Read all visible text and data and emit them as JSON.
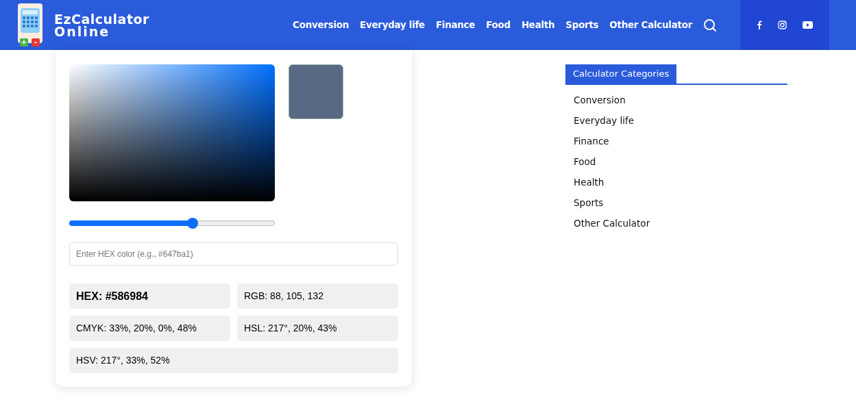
{
  "header": {
    "logo_line_1": "EzCalculator",
    "logo_line_2": "Online",
    "logo_plus": "+",
    "logo_minus": "-",
    "nav": [
      "Conversion",
      "Everyday life",
      "Finance",
      "Food",
      "Health",
      "Sports",
      "Other Calculator"
    ]
  },
  "picker": {
    "hue_slider": {
      "level": 0.6
    },
    "hex_input": {
      "placeholder": "Enter HEX color (e.g., #647ba1)"
    },
    "results": [
      {
        "text": "HEX: #586984",
        "bold": true,
        "wide": false
      },
      {
        "text": "RGB: 88, 105, 132",
        "bold": false,
        "wide": false
      },
      {
        "text": "CMYK: 33%, 20%, 0%, 48%",
        "bold": false,
        "wide": false
      },
      {
        "text": "HSL: 217°, 20%, 43%",
        "bold": false,
        "wide": false
      },
      {
        "text": "HSV: 217°, 33%, 52%",
        "bold": false,
        "wide": true
      }
    ]
  },
  "sidebar": {
    "title": "Calculator Categories",
    "items": [
      "Conversion",
      "Everyday life",
      "Finance",
      "Food",
      "Health",
      "Sports",
      "Other Calculator"
    ]
  }
}
